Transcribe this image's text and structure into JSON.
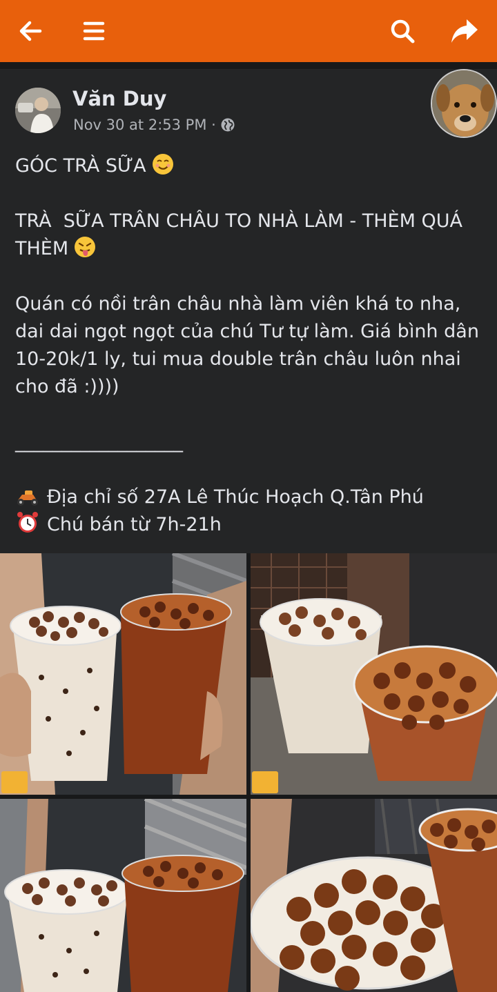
{
  "post": {
    "author": "Văn Duy",
    "timestamp": "Nov 30 at 2:53 PM ·",
    "paragraphs": [
      "GÓC TRÀ SỮA",
      "TRÀ  SỮA TRÂN CHÂU TO NHÀ LÀM - THÈM QUÁ THÈM",
      "Quán có nồi trân châu nhà làm viên khá to nha, dai dai ngọt ngọt của chú Tư tự làm. Giá bình dân 10-20k/1 ly, tui mua double trân châu luôn nhai cho đã :))))",
      "__________________",
      "Địa chỉ số 27A Lê Thúc Hoạch Q.Tân Phú",
      "Chú bán từ 7h-21h"
    ]
  },
  "colors": {
    "header": "#e8600c",
    "background": "#242526",
    "text": "#e4e6eb",
    "secondary_text": "#b0b3b8"
  },
  "icons": {
    "back": "back-arrow-icon",
    "menu": "hamburger-menu-icon",
    "search": "search-icon",
    "share": "share-arrow-icon",
    "privacy": "globe-icon"
  }
}
